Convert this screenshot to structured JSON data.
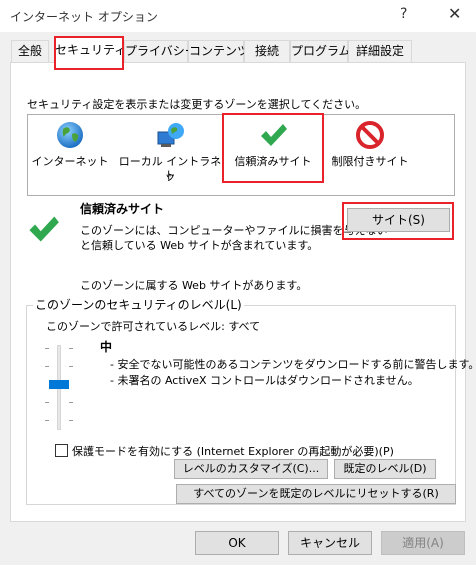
{
  "window": {
    "title": "インターネット オプション",
    "help_symbol": "?",
    "close_symbol": "✕"
  },
  "tabs": [
    {
      "label": "全般"
    },
    {
      "label": "セキュリティ",
      "active": true
    },
    {
      "label": "プライバシー"
    },
    {
      "label": "コンテンツ"
    },
    {
      "label": "接続"
    },
    {
      "label": "プログラム"
    },
    {
      "label": "詳細設定"
    }
  ],
  "zone_prompt": "セキュリティ設定を表示または変更するゾーンを選択してください。",
  "zones": [
    {
      "label": "インターネット",
      "icon": "globe-icon"
    },
    {
      "label_line1": "ローカル イントラネッ",
      "label_line2": "ト",
      "icon": "intranet-icon"
    },
    {
      "label": "信頼済みサイト",
      "icon": "checkmark-icon",
      "selected": true
    },
    {
      "label": "制限付きサイト",
      "icon": "restricted-icon"
    }
  ],
  "zone_detail": {
    "title": "信頼済みサイト",
    "description_line1": "このゾーンには、コンピューターやファイルに損害を与えない",
    "description_line2": "と信頼している Web サイトが含まれています。",
    "sites_button": "サイト(S)",
    "has_sites_text": "このゾーンに属する Web サイトがあります。"
  },
  "security_level": {
    "group_label": "このゾーンのセキュリティのレベル(L)",
    "allowed_text": "このゾーンで許可されているレベル: すべて",
    "level_name": "中",
    "bullet1": "- 安全でない可能性のあるコンテンツをダウンロードする前に警告します。",
    "bullet2": "- 未署名の ActiveX コントロールはダウンロードされません。",
    "protected_mode_label": "保護モードを有効にする (Internet Explorer の再起動が必要)(P)",
    "protected_mode_checked": false,
    "custom_button": "レベルのカスタマイズ(C)...",
    "default_button": "既定のレベル(D)",
    "reset_all_button": "すべてのゾーンを既定のレベルにリセットする(R)"
  },
  "footer": {
    "ok": "OK",
    "cancel": "キャンセル",
    "apply": "適用(A)"
  },
  "colors": {
    "highlight": "#e8212a",
    "slider": "#0078d7",
    "check": "#2fa84f",
    "restricted": "#d9242b"
  }
}
